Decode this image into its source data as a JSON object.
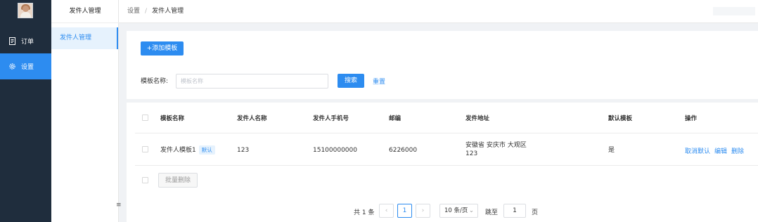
{
  "nav": {
    "items": [
      {
        "label": "订单",
        "icon": "document-icon"
      },
      {
        "label": "设置",
        "icon": "gear-icon"
      }
    ],
    "active_color": "#2d8cf0"
  },
  "submenu": {
    "title": "发件人管理",
    "items": [
      {
        "label": "发件人管理"
      }
    ],
    "collapse_icon": "≡"
  },
  "breadcrumb": [
    "设置",
    "发件人管理"
  ],
  "breadcrumb_sep": "/",
  "toolbar": {
    "add_label": "+添加模板"
  },
  "filter": {
    "label": "模板名称:",
    "placeholder": "模板名称",
    "search_label": "搜索",
    "reset_label": "重置"
  },
  "table": {
    "columns": [
      "模板名称",
      "发件人名称",
      "发件人手机号",
      "邮编",
      "发件地址",
      "默认模板",
      "操作"
    ],
    "rows": [
      {
        "template_name": "发件人模板1",
        "tag": "默认",
        "sender_name": "123",
        "phone": "15100000000",
        "zip": "6226000",
        "address_line1": "安徽省 安庆市 大观区",
        "address_line2": "123",
        "is_default": "是",
        "actions": [
          "取消默认",
          "编辑",
          "删除"
        ]
      }
    ],
    "batch_delete_label": "批量删除"
  },
  "pagination": {
    "total_label": "共 1 条",
    "prev": "‹",
    "current_page": "1",
    "next": "›",
    "page_size_label": "10 条/页",
    "jump_label": "跳至",
    "jump_value": "1",
    "jump_suffix": "页"
  }
}
